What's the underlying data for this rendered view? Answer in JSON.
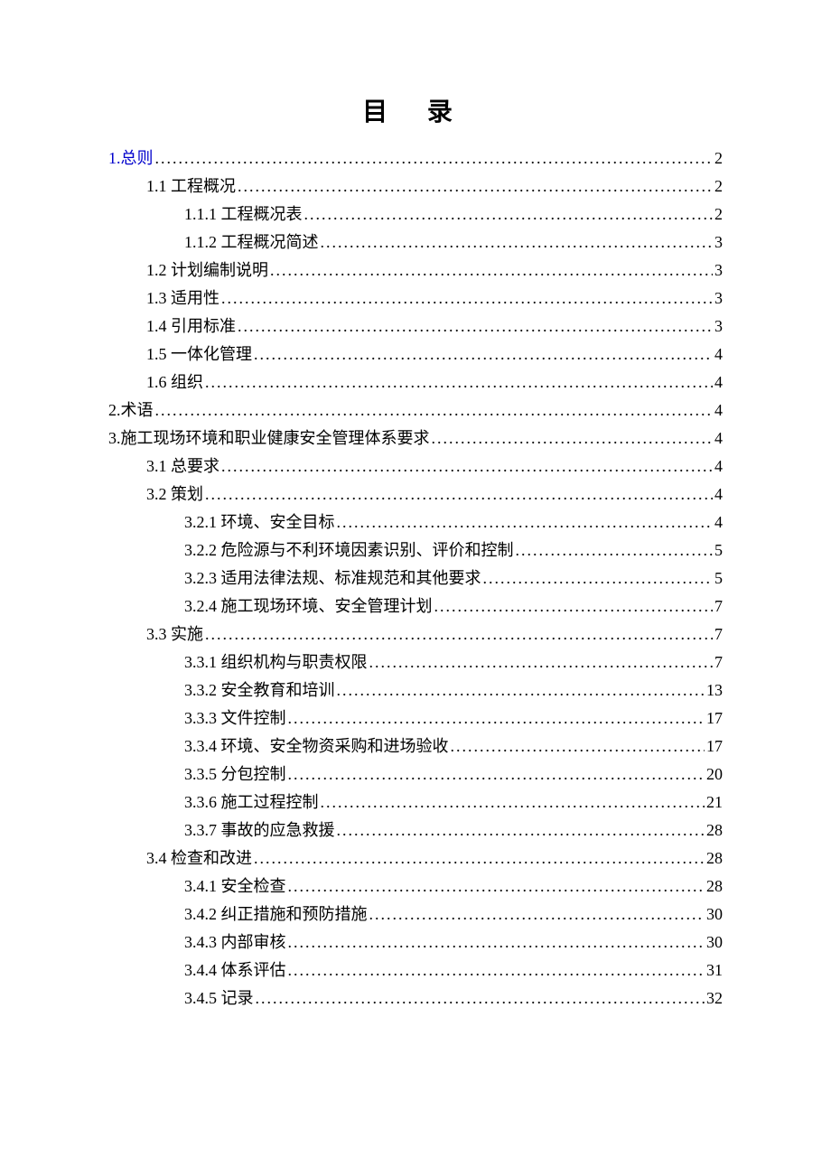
{
  "title": "目 录",
  "toc": [
    {
      "level": 1,
      "label": "1.总则",
      "page": "2",
      "link": true
    },
    {
      "level": 2,
      "label": "1.1 工程概况",
      "page": "2",
      "link": false
    },
    {
      "level": 3,
      "label": "1.1.1 工程概况表",
      "page": "2",
      "link": false
    },
    {
      "level": 3,
      "label": "1.1.2 工程概况简述",
      "page": "3",
      "link": false
    },
    {
      "level": 2,
      "label": "1.2 计划编制说明",
      "page": "3",
      "link": false
    },
    {
      "level": 2,
      "label": "1.3 适用性",
      "page": "3",
      "link": false
    },
    {
      "level": 2,
      "label": "1.4 引用标准",
      "page": "3",
      "link": false
    },
    {
      "level": 2,
      "label": "1.5 一体化管理",
      "page": "4",
      "link": false
    },
    {
      "level": 2,
      "label": "1.6 组织",
      "page": "4",
      "link": false
    },
    {
      "level": 1,
      "label": "2.术语",
      "page": "4",
      "link": false
    },
    {
      "level": 1,
      "label": "3.施工现场环境和职业健康安全管理体系要求",
      "page": "4",
      "link": false
    },
    {
      "level": 2,
      "label": "3.1 总要求",
      "page": "4",
      "link": false
    },
    {
      "level": 2,
      "label": "3.2 策划",
      "page": "4",
      "link": false
    },
    {
      "level": 3,
      "label": "3.2.1 环境、安全目标",
      "page": "4",
      "link": false
    },
    {
      "level": 3,
      "label": "3.2.2  危险源与不利环境因素识别、评价和控制",
      "page": "5",
      "link": false
    },
    {
      "level": 3,
      "label": "3.2.3 适用法律法规、标准规范和其他要求",
      "page": "5",
      "link": false
    },
    {
      "level": 3,
      "label": "3.2.4  施工现场环境、安全管理计划",
      "page": "7",
      "link": false
    },
    {
      "level": 2,
      "label": "3.3 实施",
      "page": "7",
      "link": false
    },
    {
      "level": 3,
      "label": "3.3.1 组织机构与职责权限",
      "page": "7",
      "link": false
    },
    {
      "level": 3,
      "label": "3.3.2 安全教育和培训",
      "page": "13",
      "link": false
    },
    {
      "level": 3,
      "label": "3.3.3 文件控制",
      "page": "17",
      "link": false
    },
    {
      "level": 3,
      "label": "3.3.4 环境、安全物资采购和进场验收",
      "page": "17",
      "link": false
    },
    {
      "level": 3,
      "label": "3.3.5 分包控制",
      "page": "20",
      "link": false
    },
    {
      "level": 3,
      "label": "3.3.6 施工过程控制",
      "page": "21",
      "link": false
    },
    {
      "level": 3,
      "label": "3.3.7 事故的应急救援",
      "page": "28",
      "link": false
    },
    {
      "level": 2,
      "label": "3.4 检查和改进",
      "page": "28",
      "link": false
    },
    {
      "level": 3,
      "label": "3.4.1 安全检查",
      "page": "28",
      "link": false
    },
    {
      "level": 3,
      "label": "3.4.2 纠正措施和预防措施",
      "page": "30",
      "link": false
    },
    {
      "level": 3,
      "label": "3.4.3 内部审核",
      "page": "30",
      "link": false
    },
    {
      "level": 3,
      "label": "3.4.4 体系评估",
      "page": "31",
      "link": false
    },
    {
      "level": 3,
      "label": "3.4.5 记录",
      "page": "32",
      "link": false
    }
  ]
}
